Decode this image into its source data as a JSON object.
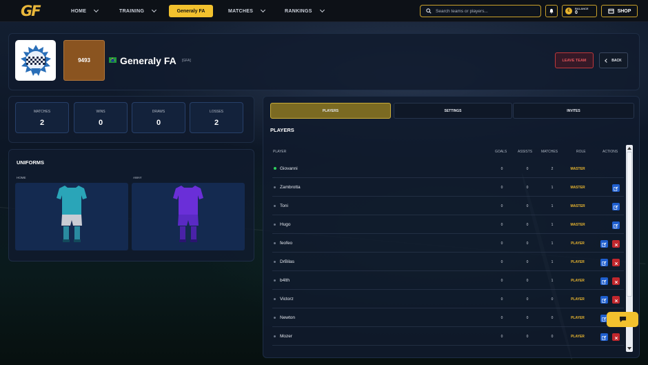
{
  "nav": {
    "logo": "GF",
    "items": [
      {
        "label": "HOME"
      },
      {
        "label": "TRAINING"
      },
      {
        "label": "Generaly FA"
      },
      {
        "label": "MATCHES"
      },
      {
        "label": "RANKINGS"
      }
    ],
    "search_placeholder": "Search teams or players...",
    "balance_label": "BALANCE",
    "balance_value": "0",
    "coin_symbol": "€",
    "shop_label": "SHOP"
  },
  "team": {
    "rating": "9493",
    "name": "Generaly FA",
    "tag": "[GFA]",
    "flag_icon": "brazil-flag-icon",
    "leave_label": "LEAVE TEAM",
    "back_label": "BACK"
  },
  "stats": [
    {
      "label": "MATCHES",
      "value": "2"
    },
    {
      "label": "WINS",
      "value": "0"
    },
    {
      "label": "DRAWS",
      "value": "0"
    },
    {
      "label": "LOSSES",
      "value": "2"
    }
  ],
  "uniforms": {
    "title": "UNIFORMS",
    "home_label": "HOME",
    "away_label": "AWAY",
    "home_colors": {
      "shirt": "#2aa5b8",
      "shorts": "#c9ccd4",
      "socks": "#2a8aa0"
    },
    "away_colors": {
      "shirt": "#6a2fd8",
      "shorts": "#5a2ac4",
      "socks": "#4a22a8"
    }
  },
  "tabs": [
    {
      "label": "PLAYERS"
    },
    {
      "label": "SETTINGS"
    },
    {
      "label": "INVITES"
    }
  ],
  "players": {
    "title": "PLAYERS",
    "columns": [
      "PLAYER",
      "GOALS",
      "ASSISTS",
      "MATCHES",
      "ROLE",
      "ACTIONS"
    ],
    "rows": [
      {
        "name": "Giovanni",
        "goals": "0",
        "assists": "0",
        "matches": "2",
        "role": "MASTER",
        "online": true,
        "edit": false,
        "remove": false
      },
      {
        "name": "Zambrotta",
        "goals": "0",
        "assists": "0",
        "matches": "1",
        "role": "MASTER",
        "online": false,
        "edit": true,
        "remove": false
      },
      {
        "name": "Toni",
        "goals": "0",
        "assists": "0",
        "matches": "1",
        "role": "MASTER",
        "online": false,
        "edit": true,
        "remove": false
      },
      {
        "name": "Hugo",
        "goals": "0",
        "assists": "0",
        "matches": "1",
        "role": "MASTER",
        "online": false,
        "edit": true,
        "remove": false
      },
      {
        "name": "feofeo",
        "goals": "0",
        "assists": "0",
        "matches": "1",
        "role": "PLAYER",
        "online": false,
        "edit": true,
        "remove": true
      },
      {
        "name": "DrBilas",
        "goals": "0",
        "assists": "0",
        "matches": "1",
        "role": "PLAYER",
        "online": false,
        "edit": true,
        "remove": true
      },
      {
        "name": "b4lth",
        "goals": "0",
        "assists": "0",
        "matches": "1",
        "role": "PLAYER",
        "online": false,
        "edit": true,
        "remove": true
      },
      {
        "name": "Victorz",
        "goals": "0",
        "assists": "0",
        "matches": "0",
        "role": "PLAYER",
        "online": false,
        "edit": true,
        "remove": true
      },
      {
        "name": "Newton",
        "goals": "0",
        "assists": "0",
        "matches": "0",
        "role": "PLAYER",
        "online": false,
        "edit": true,
        "remove": true
      },
      {
        "name": "Mozer",
        "goals": "0",
        "assists": "0",
        "matches": "0",
        "role": "PLAYER",
        "online": false,
        "edit": true,
        "remove": true
      }
    ]
  },
  "colors": {
    "accent": "#f2c12e",
    "danger": "#c1272d",
    "edit": "#1f5fcf",
    "online": "#2fd05e"
  }
}
